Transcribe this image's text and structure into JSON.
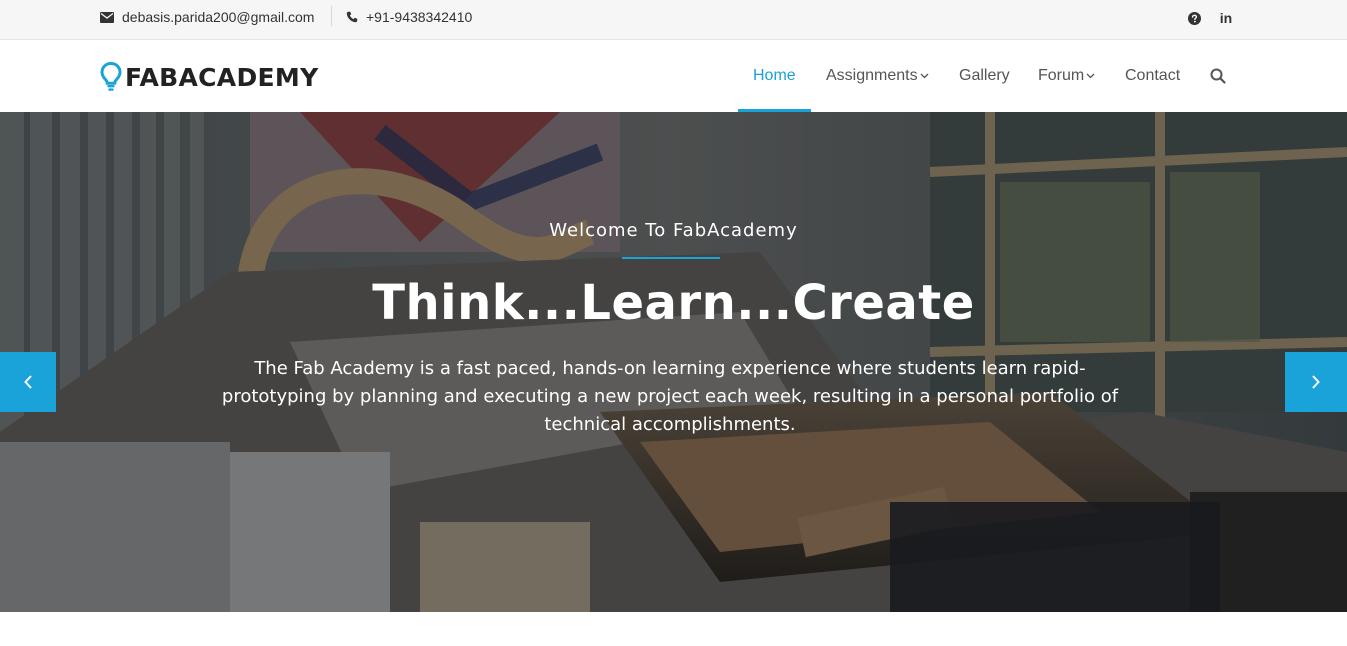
{
  "topbar": {
    "email": "debasis.parida200@gmail.com",
    "phone": "+91-9438342410",
    "help_icon": "question-circle-icon",
    "linkedin_label": "in"
  },
  "header": {
    "logo_text": "FABACADEMY",
    "logo_icon": "lightbulb-icon",
    "nav": {
      "home": "Home",
      "assignments": "Assignments",
      "gallery": "Gallery",
      "forum": "Forum",
      "contact": "Contact"
    },
    "search_icon": "search-icon",
    "accent_color": "#1aa3d8"
  },
  "hero": {
    "subtitle": "Welcome To FabAcademy",
    "title": "Think...Learn...Create",
    "text": "The Fab Academy is a fast paced, hands-on learning experience where students learn rapid-prototyping by planning and executing a new project each week, resulting in a personal portfolio of technical accomplishments.",
    "prev_icon": "chevron-left-icon",
    "next_icon": "chevron-right-icon"
  }
}
